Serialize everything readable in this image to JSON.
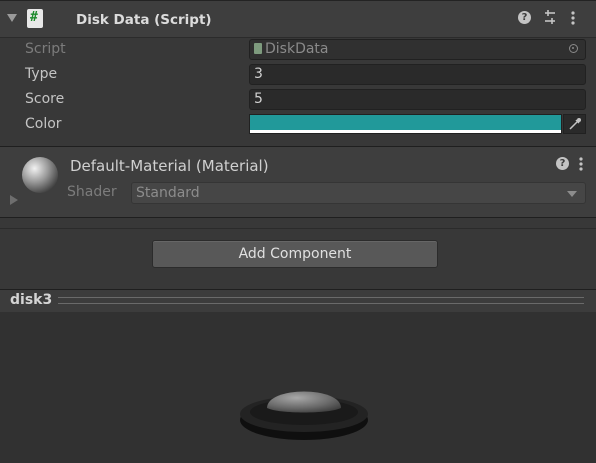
{
  "script_component": {
    "title": "Disk Data (Script)",
    "script_label": "Script",
    "script_value": "DiskData",
    "fields": [
      {
        "label": "Type",
        "value": "3"
      },
      {
        "label": "Score",
        "value": "5"
      }
    ],
    "color_label": "Color",
    "color_value": "#21999a",
    "icons": {
      "help": "help-icon",
      "presets": "presets-icon",
      "menu": "kebab-menu-icon"
    }
  },
  "material": {
    "title": "Default-Material (Material)",
    "shader_label": "Shader",
    "shader_value": "Standard"
  },
  "add_component_label": "Add Component",
  "preview": {
    "title": "disk3"
  }
}
